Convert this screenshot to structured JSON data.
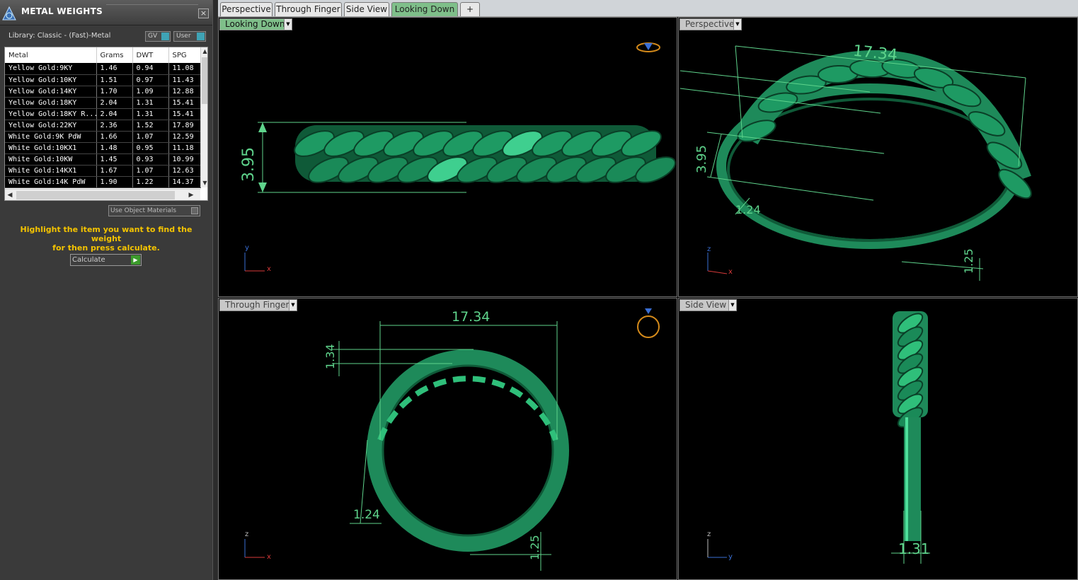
{
  "panel": {
    "title": "METAL WEIGHTS",
    "close_glyph": "×",
    "library_label": "Library: Classic - (Fast)-Metal",
    "gv_label": "GV",
    "user_label": "User",
    "columns": [
      "Metal",
      "Grams",
      "DWT",
      "SPG"
    ],
    "rows": [
      [
        "Yellow Gold:9KY",
        "1.46",
        "0.94",
        "11.08"
      ],
      [
        "Yellow Gold:10KY",
        "1.51",
        "0.97",
        "11.43"
      ],
      [
        "Yellow Gold:14KY",
        "1.70",
        "1.09",
        "12.88"
      ],
      [
        "Yellow Gold:18KY",
        "2.04",
        "1.31",
        "15.41"
      ],
      [
        "Yellow Gold:18KY R...",
        "2.04",
        "1.31",
        "15.41"
      ],
      [
        "Yellow Gold:22KY",
        "2.36",
        "1.52",
        "17.89"
      ],
      [
        "White Gold:9K PdW",
        "1.66",
        "1.07",
        "12.59"
      ],
      [
        "White Gold:10KX1",
        "1.48",
        "0.95",
        "11.18"
      ],
      [
        "White Gold:10KW",
        "1.45",
        "0.93",
        "10.99"
      ],
      [
        "White Gold:14KX1",
        "1.67",
        "1.07",
        "12.63"
      ],
      [
        "White Gold:14K PdW",
        "1.90",
        "1.22",
        "14.37"
      ]
    ],
    "use_object_materials": "Use Object Materials",
    "hint_line1": "Highlight the item you want to find the weight",
    "hint_line2": "for then press calculate.",
    "calculate_label": "Calculate",
    "icons": {
      "logo": "rhino-jewel-icon",
      "close": "close-icon",
      "go": "play-arrow-icon"
    }
  },
  "tabs": [
    "Perspective",
    "Through Finger",
    "Side View",
    "Looking Down"
  ],
  "active_tab": "Looking Down",
  "add_tab_glyph": "+",
  "viewports": {
    "looking_down": {
      "label": "Looking Down",
      "dims": {
        "height": "3.95"
      },
      "axes": [
        "y",
        "x"
      ]
    },
    "perspective": {
      "label": "Perspective",
      "dims": {
        "width": "17.34",
        "height": "3.95",
        "thick1": "1.24",
        "thick2": "1.25"
      },
      "axes": [
        "z",
        "x"
      ]
    },
    "through_finger": {
      "label": "Through Finger",
      "dims": {
        "width": "17.34",
        "top": "1.34",
        "left": "1.24",
        "bottom": "1.25"
      },
      "axes": [
        "z",
        "x"
      ]
    },
    "side_view": {
      "label": "Side View",
      "dims": {
        "width": "1.31"
      },
      "axes": [
        "z",
        "y"
      ]
    }
  },
  "colors": {
    "model": "#1e8a5a",
    "dimension": "#5fd48c",
    "active": "#7fbf8a",
    "hint": "#f5c400"
  }
}
